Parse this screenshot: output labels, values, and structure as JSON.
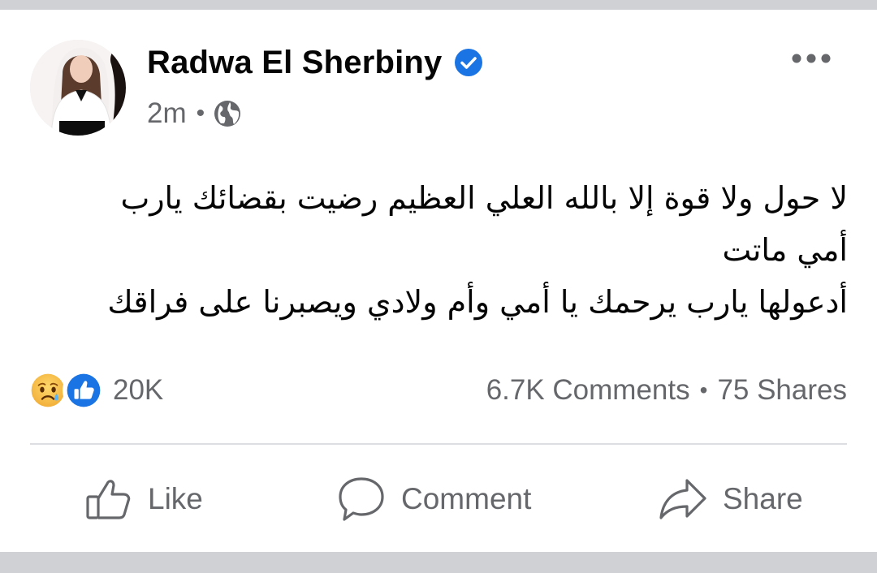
{
  "post": {
    "author_name": "Radwa El Sherbiny",
    "time": "2m",
    "separator": "•",
    "text_lines": [
      "لا حول ولا قوة إلا بالله العلي العظيم رضيت بقضائك يارب",
      "أمي ماتت",
      "أدعولها يارب يرحمك يا أمي وأم ولادي ويصبرنا على فراقك"
    ]
  },
  "icons": {
    "verified": "verified-badge-icon",
    "privacy": "globe-icon",
    "more": "more-options-icon",
    "reactions": [
      "sad-reaction-icon",
      "like-reaction-icon"
    ],
    "actions": [
      "thumbs-up-icon",
      "comment-bubble-icon",
      "share-arrow-icon"
    ]
  },
  "stats": {
    "reactions_count": "20K",
    "comments": "6.7K Comments",
    "separator": "•",
    "shares": "75 Shares"
  },
  "actions": {
    "like": "Like",
    "comment": "Comment",
    "share": "Share"
  },
  "colors": {
    "brand_blue": "#1b74e4",
    "text_primary": "#050505",
    "text_secondary": "#65676b",
    "background": "#cfd1d5"
  }
}
